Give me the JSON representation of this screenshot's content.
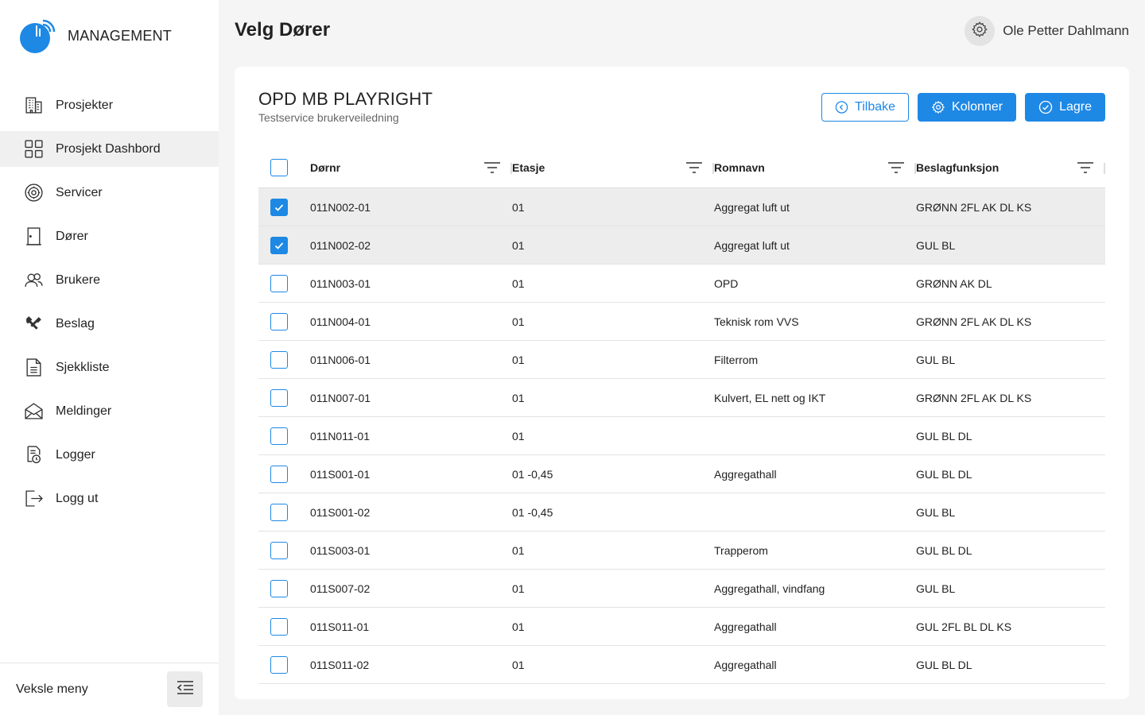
{
  "app": {
    "brand": "MANAGEMENT",
    "accent": "#1e88e5"
  },
  "sidebar": {
    "items": [
      {
        "label": "Prosjekter",
        "icon": "building-icon",
        "active": false
      },
      {
        "label": "Prosjekt Dashbord",
        "icon": "dashboard-grid-icon",
        "active": true
      },
      {
        "label": "Servicer",
        "icon": "service-gear-icon",
        "active": false
      },
      {
        "label": "Dører",
        "icon": "door-icon",
        "active": false
      },
      {
        "label": "Brukere",
        "icon": "users-icon",
        "active": false
      },
      {
        "label": "Beslag",
        "icon": "tools-icon",
        "active": false
      },
      {
        "label": "Sjekkliste",
        "icon": "document-icon",
        "active": false
      },
      {
        "label": "Meldinger",
        "icon": "envelope-icon",
        "active": false
      },
      {
        "label": "Logger",
        "icon": "log-clock-icon",
        "active": false
      },
      {
        "label": "Logg ut",
        "icon": "logout-icon",
        "active": false
      }
    ],
    "footer_label": "Veksle meny"
  },
  "header": {
    "title": "Velg Dører",
    "user_name": "Ole Petter Dahlmann"
  },
  "project": {
    "name": "OPD MB PLAYRIGHT",
    "subtitle": "Testservice brukerveiledning"
  },
  "actions": {
    "back_label": "Tilbake",
    "columns_label": "Kolonner",
    "save_label": "Lagre"
  },
  "table": {
    "columns": [
      "Dørnr",
      "Etasje",
      "Romnavn",
      "Beslagfunksjon"
    ],
    "rows": [
      {
        "checked": true,
        "dornr": "011N002-01",
        "etasje": "01",
        "romnavn": "Aggregat luft ut",
        "beslag": "GRØNN 2FL AK DL KS"
      },
      {
        "checked": true,
        "dornr": "011N002-02",
        "etasje": "01",
        "romnavn": "Aggregat luft ut",
        "beslag": "GUL BL"
      },
      {
        "checked": false,
        "dornr": "011N003-01",
        "etasje": "01",
        "romnavn": "OPD",
        "beslag": "GRØNN AK DL"
      },
      {
        "checked": false,
        "dornr": "011N004-01",
        "etasje": "01",
        "romnavn": "Teknisk rom VVS",
        "beslag": "GRØNN 2FL AK DL KS"
      },
      {
        "checked": false,
        "dornr": "011N006-01",
        "etasje": "01",
        "romnavn": "Filterrom",
        "beslag": "GUL BL"
      },
      {
        "checked": false,
        "dornr": "011N007-01",
        "etasje": "01",
        "romnavn": "Kulvert, EL nett og IKT",
        "beslag": "GRØNN 2FL AK DL KS"
      },
      {
        "checked": false,
        "dornr": "011N011-01",
        "etasje": "01",
        "romnavn": "",
        "beslag": "GUL BL DL"
      },
      {
        "checked": false,
        "dornr": "011S001-01",
        "etasje": "01 -0,45",
        "romnavn": "Aggregathall",
        "beslag": "GUL BL DL"
      },
      {
        "checked": false,
        "dornr": "011S001-02",
        "etasje": "01 -0,45",
        "romnavn": "",
        "beslag": "GUL BL"
      },
      {
        "checked": false,
        "dornr": "011S003-01",
        "etasje": "01",
        "romnavn": "Trapperom",
        "beslag": "GUL BL DL"
      },
      {
        "checked": false,
        "dornr": "011S007-02",
        "etasje": "01",
        "romnavn": "Aggregathall, vindfang",
        "beslag": "GUL BL"
      },
      {
        "checked": false,
        "dornr": "011S011-01",
        "etasje": "01",
        "romnavn": "Aggregathall",
        "beslag": "GUL 2FL BL DL KS"
      },
      {
        "checked": false,
        "dornr": "011S011-02",
        "etasje": "01",
        "romnavn": "Aggregathall",
        "beslag": "GUL BL DL"
      }
    ]
  }
}
